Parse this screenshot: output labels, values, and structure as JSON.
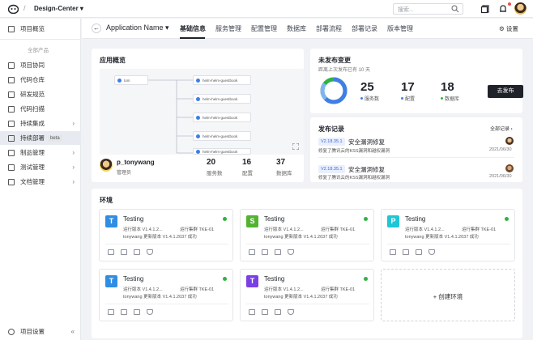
{
  "topbar": {
    "project": "Design-Center",
    "search_placeholder": "搜索..."
  },
  "sidebar": {
    "items": [
      {
        "label": "项目概览",
        "chev": ""
      },
      {
        "label": "项目协同",
        "chev": ""
      },
      {
        "label": "代码仓库",
        "chev": ""
      },
      {
        "label": "研发规范",
        "chev": ""
      },
      {
        "label": "代码扫描",
        "chev": ""
      },
      {
        "label": "持续集成",
        "chev": "›"
      },
      {
        "label": "持续部署",
        "chev": ""
      },
      {
        "label": "制品管理",
        "chev": "›"
      },
      {
        "label": "测试管理",
        "chev": "›"
      },
      {
        "label": "文档管理",
        "chev": "›"
      }
    ],
    "group_label": "全部产品",
    "beta": "beta",
    "footer_label": "项目设置",
    "collapse": "«"
  },
  "appbar": {
    "app_name": "Application Name",
    "tabs": [
      "基础信息",
      "服务管理",
      "配置管理",
      "数据库",
      "部署流程",
      "部署记录",
      "版本管理"
    ],
    "settings": "设置"
  },
  "overview": {
    "title": "应用概览",
    "root_node": "tom",
    "child_nodes": [
      "helm-helm-guestbook",
      "helm-helm-guestbook",
      "helm-helm-guestbook",
      "helm-helm-guestbook",
      "helm-helm-guestbook"
    ],
    "owner_name": "p_tonywang",
    "owner_role": "管理员",
    "stats": [
      {
        "value": "20",
        "label": "服务数"
      },
      {
        "value": "16",
        "label": "配置"
      },
      {
        "value": "37",
        "label": "数据库"
      }
    ]
  },
  "unpublished": {
    "title": "未发布变更",
    "subtitle": "距离上次发布已有 10 天",
    "stats": [
      {
        "value": "25",
        "label": "服务数",
        "color": "#3f7ee8"
      },
      {
        "value": "17",
        "label": "配置",
        "color": "#3f7ee8"
      },
      {
        "value": "18",
        "label": "数据库",
        "color": "#2fb344"
      }
    ],
    "publish_button": "去发布"
  },
  "releases": {
    "title": "发布记录",
    "all_link": "全部记录 ›",
    "items": [
      {
        "version": "V2.18.35.1",
        "title": "安全漏洞修复",
        "desc": "修复了腾讯云的KSS漏洞和越权漏洞",
        "date": "2021/06/30"
      },
      {
        "version": "V2.18.35.1",
        "title": "安全漏洞修复",
        "desc": "修复了腾讯云的KSS漏洞和越权漏洞",
        "date": "2021/06/30"
      }
    ]
  },
  "environments": {
    "title": "环境",
    "items": [
      {
        "letter": "T",
        "color": "#2f8de4",
        "name": "Testing",
        "version": "运行版本 V1.4.1.2...",
        "cluster": "运行集群 TKE-01",
        "update": "tonywang 更新版本 V1.4.1.2037 成功"
      },
      {
        "letter": "S",
        "color": "#52b331",
        "name": "Testing",
        "version": "运行版本 V1.4.1.2...",
        "cluster": "运行集群 TKE-01",
        "update": "tonywang 更新版本 V1.4.1.2037 成功"
      },
      {
        "letter": "P",
        "color": "#1ec6d6",
        "name": "Testing",
        "version": "运行版本 V1.4.1.2...",
        "cluster": "运行集群 TKE-01",
        "update": "tonywang 更新版本 V1.4.1.2037 成功"
      },
      {
        "letter": "T",
        "color": "#2f8de4",
        "name": "Testing",
        "version": "运行版本 V1.4.1.2...",
        "cluster": "运行集群 TKE-01",
        "update": "tonywang 更新版本 V1.4.1.2037 成功"
      },
      {
        "letter": "T",
        "color": "#7b3fe4",
        "name": "Testing",
        "version": "运行版本 V1.4.1.2...",
        "cluster": "运行集群 TKE-01",
        "update": "tonywang 更新版本 V1.4.1.2037 成功"
      }
    ],
    "create_label": "+ 创建环境"
  }
}
